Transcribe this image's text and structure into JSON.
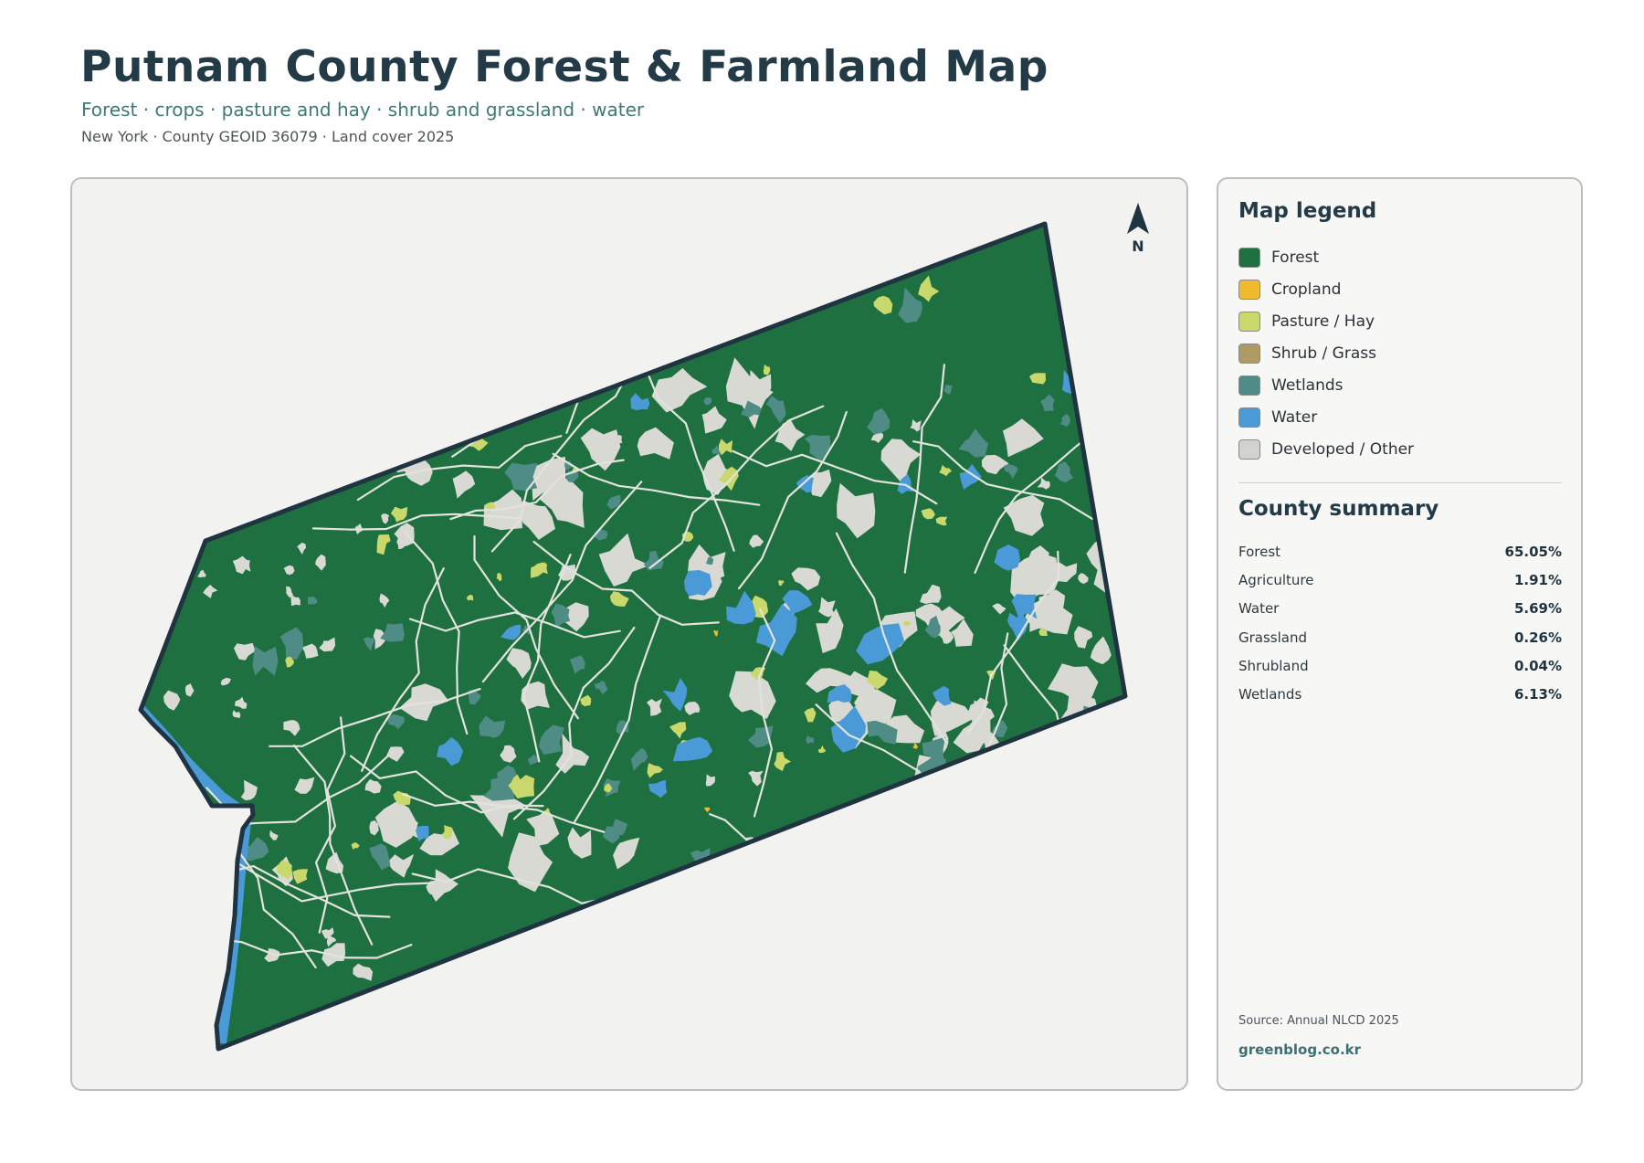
{
  "header": {
    "title": "Putnam County Forest & Farmland Map",
    "subtitle": "Forest · crops · pasture and hay · shrub and grassland · water",
    "meta": "New York · County GEOID 36079 · Land cover 2025"
  },
  "map": {
    "north_label": "N",
    "north_icon": "north-arrow-icon",
    "colors": {
      "forest": "#1f7040",
      "cropland": "#f0b92e",
      "pasture": "#c9d86a",
      "shrub": "#b09a64",
      "wetlands": "#4f8c86",
      "water": "#4a9ad8",
      "developed": "#d9d9d4",
      "outline": "#1f3340"
    }
  },
  "legend": {
    "heading": "Map legend",
    "items": [
      {
        "label": "Forest",
        "color": "#1f7040"
      },
      {
        "label": "Cropland",
        "color": "#f0b92e"
      },
      {
        "label": "Pasture / Hay",
        "color": "#c9d86a"
      },
      {
        "label": "Shrub / Grass",
        "color": "#b09a64"
      },
      {
        "label": "Wetlands",
        "color": "#4f8c86"
      },
      {
        "label": "Water",
        "color": "#4a9ad8"
      },
      {
        "label": "Developed / Other",
        "color": "#d2d2ce"
      }
    ]
  },
  "summary": {
    "heading": "County summary",
    "rows": [
      {
        "label": "Forest",
        "value": "65.05%"
      },
      {
        "label": "Agriculture",
        "value": "1.91%"
      },
      {
        "label": "Water",
        "value": "5.69%"
      },
      {
        "label": "Grassland",
        "value": "0.26%"
      },
      {
        "label": "Shrubland",
        "value": "0.04%"
      },
      {
        "label": "Wetlands",
        "value": "6.13%"
      }
    ]
  },
  "footer": {
    "source": "Source: Annual NLCD 2025",
    "credit": "greenblog.co.kr"
  }
}
